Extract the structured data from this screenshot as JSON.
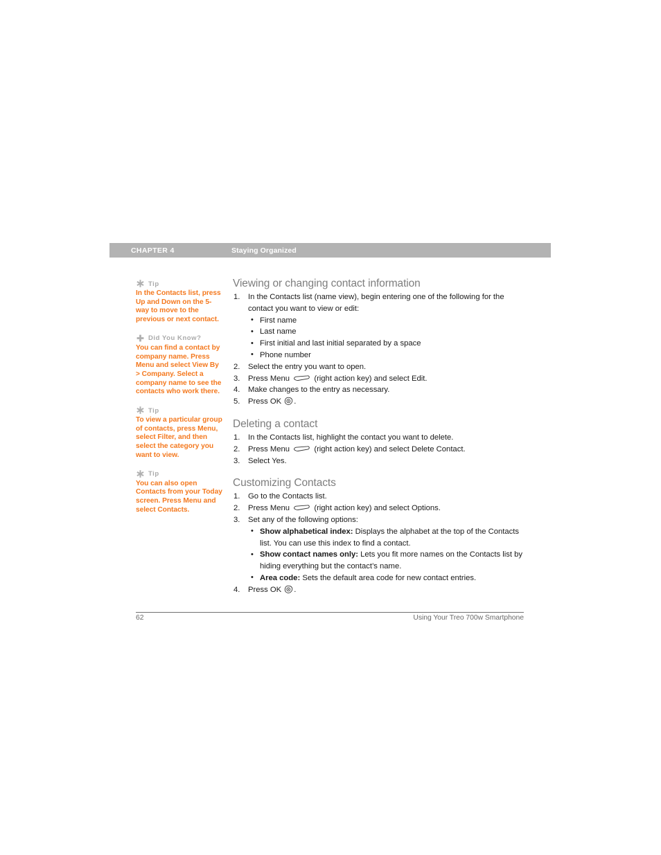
{
  "header": {
    "chapter": "CHAPTER 4",
    "section": "Staying Organized"
  },
  "sidebar": {
    "tips": [
      {
        "icon": "asterisk-icon",
        "label": "Tip",
        "body": "In the Contacts list, press Up and Down on the 5-way to move to the previous or next contact."
      },
      {
        "icon": "plus-icon",
        "label": "Did You Know?",
        "body": "You can find a contact by company name. Press Menu and select View By > Company. Select a company name to see the contacts who work there."
      },
      {
        "icon": "asterisk-icon",
        "label": "Tip",
        "body": "To view a particular group of contacts, press Menu, select Filter, and then select the category you want to view."
      },
      {
        "icon": "asterisk-icon",
        "label": "Tip",
        "body": "You can also open Contacts from your Today screen. Press Menu and select Contacts."
      }
    ]
  },
  "main": {
    "sections": [
      {
        "heading": "Viewing or changing contact information",
        "steps": [
          {
            "text_before": "In the Contacts list (name view), begin entering one of the following for the contact you want to view or edit:",
            "sub_bullets": [
              "First name",
              "Last name",
              "First initial and last initial separated by a space",
              "Phone number"
            ]
          },
          {
            "text_before": "Select the entry you want to open."
          },
          {
            "text_before": "Press Menu ",
            "key": "menu-key-icon",
            "text_after": " (right action key) and select Edit."
          },
          {
            "text_before": "Make changes to the entry as necessary."
          },
          {
            "text_before": "Press OK ",
            "key": "ok-key-icon",
            "text_after": "."
          }
        ]
      },
      {
        "heading": "Deleting a contact",
        "steps": [
          {
            "text_before": "In the Contacts list, highlight the contact you want to delete."
          },
          {
            "text_before": "Press Menu ",
            "key": "menu-key-icon",
            "text_after": " (right action key) and select Delete Contact."
          },
          {
            "text_before": "Select Yes."
          }
        ]
      },
      {
        "heading": "Customizing Contacts",
        "steps": [
          {
            "text_before": "Go to the Contacts list."
          },
          {
            "text_before": "Press Menu ",
            "key": "menu-key-icon",
            "text_after": " (right action key) and select Options."
          },
          {
            "text_before": "Set any of the following options:",
            "option_bullets": [
              {
                "name": "Show alphabetical index:",
                "desc": " Displays the alphabet at the top of the Contacts list. You can use this index to find a contact."
              },
              {
                "name": "Show contact names only:",
                "desc": " Lets you fit more names on the Contacts list by hiding everything but the contact’s name."
              },
              {
                "name": "Area code:",
                "desc": " Sets the default area code for new contact entries."
              }
            ]
          },
          {
            "text_before": "Press OK ",
            "key": "ok-key-icon",
            "text_after": "."
          }
        ]
      }
    ]
  },
  "footer": {
    "page_number": "62",
    "book_title": "Using Your Treo 700w Smartphone"
  },
  "colors": {
    "header_bar": "#b3b3b3",
    "tip_orange": "#f4791f",
    "tip_label_gray": "#aaaaaa",
    "heading_gray": "#7d7d7d",
    "body_black": "#1a1a1a",
    "footer_gray": "#6a6a6a"
  }
}
